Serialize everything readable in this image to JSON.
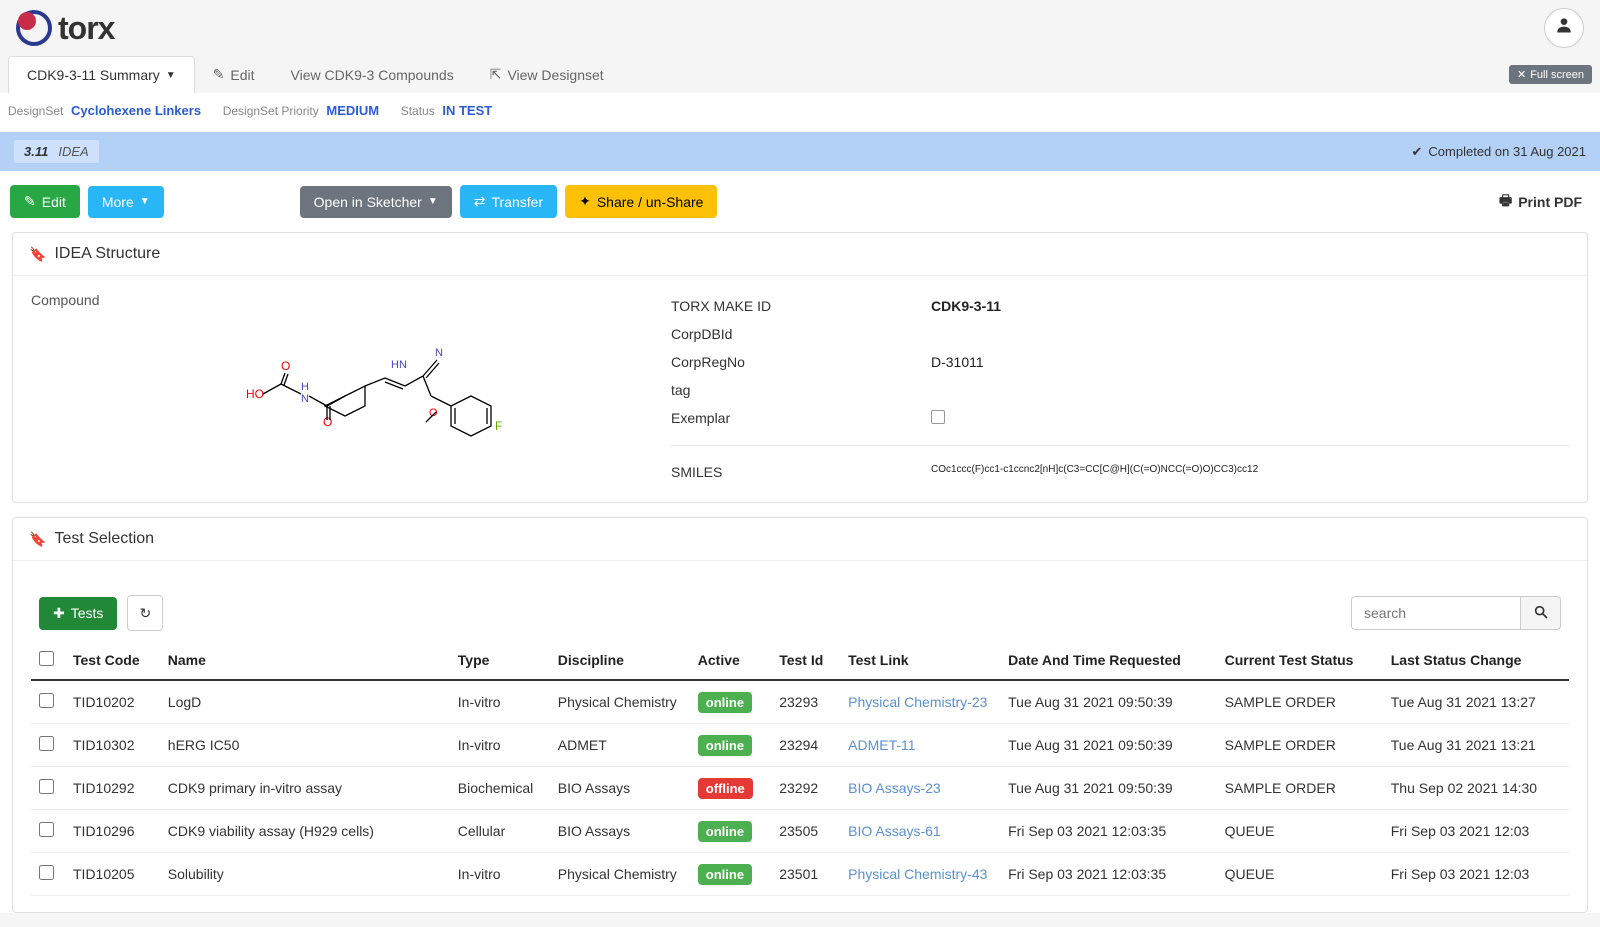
{
  "logo_text": "torx",
  "tabs": {
    "summary": "CDK9-3-11 Summary",
    "edit": "Edit",
    "view_compounds": "View CDK9-3 Compounds",
    "view_designset": "View Designset"
  },
  "fullscreen": "Full screen",
  "meta": {
    "designset_lbl": "DesignSet",
    "designset_val": "Cyclohexene Linkers",
    "priority_lbl": "DesignSet Priority",
    "priority_val": "MEDIUM",
    "status_lbl": "Status",
    "status_val": "IN TEST"
  },
  "idea_banner": {
    "num": "3.11",
    "label": "IDEA",
    "completed": "Completed on 31 Aug 2021"
  },
  "actions": {
    "edit": "Edit",
    "more": "More",
    "sketcher": "Open in Sketcher",
    "transfer": "Transfer",
    "share": "Share / un-Share",
    "print": "Print PDF"
  },
  "structure": {
    "header": "IDEA Structure",
    "compound_lbl": "Compound",
    "torx_make_id_lbl": "TORX MAKE ID",
    "torx_make_id_val": "CDK9-3-11",
    "corpdbid_lbl": "CorpDBId",
    "corpdbid_val": "",
    "corpregno_lbl": "CorpRegNo",
    "corpregno_val": "D-31011",
    "tag_lbl": "tag",
    "tag_val": "",
    "exemplar_lbl": "Exemplar",
    "smiles_lbl": "SMILES",
    "smiles_val": "COc1ccc(F)cc1-c1ccnc2[nH]c(C3=CC[C@H](C(=O)NCC(=O)O)CC3)cc12"
  },
  "tests_panel": {
    "header": "Test Selection",
    "add_btn": "Tests",
    "search_placeholder": "search"
  },
  "table": {
    "headers": {
      "code": "Test Code",
      "name": "Name",
      "type": "Type",
      "discipline": "Discipline",
      "active": "Active",
      "testid": "Test Id",
      "testlink": "Test Link",
      "requested": "Date And Time Requested",
      "status": "Current Test Status",
      "lastchange": "Last Status Change"
    },
    "rows": [
      {
        "code": "TID10202",
        "name": "LogD",
        "type": "In-vitro",
        "discipline": "Physical Chemistry",
        "active": "online",
        "testid": "23293",
        "testlink": "Physical Chemistry-23",
        "requested": "Tue Aug 31 2021 09:50:39",
        "status": "SAMPLE ORDER",
        "lastchange": "Tue Aug 31 2021 13:27"
      },
      {
        "code": "TID10302",
        "name": "hERG IC50",
        "type": "In-vitro",
        "discipline": "ADMET",
        "active": "online",
        "testid": "23294",
        "testlink": "ADMET-11",
        "requested": "Tue Aug 31 2021 09:50:39",
        "status": "SAMPLE ORDER",
        "lastchange": "Tue Aug 31 2021 13:21"
      },
      {
        "code": "TID10292",
        "name": "CDK9 primary in-vitro assay",
        "type": "Biochemical",
        "discipline": "BIO Assays",
        "active": "offline",
        "testid": "23292",
        "testlink": "BIO Assays-23",
        "requested": "Tue Aug 31 2021 09:50:39",
        "status": "SAMPLE ORDER",
        "lastchange": "Thu Sep 02 2021 14:30"
      },
      {
        "code": "TID10296",
        "name": "CDK9 viability assay (H929 cells)",
        "type": "Cellular",
        "discipline": "BIO Assays",
        "active": "online",
        "testid": "23505",
        "testlink": "BIO Assays-61",
        "requested": "Fri Sep 03 2021 12:03:35",
        "status": "QUEUE",
        "lastchange": "Fri Sep 03 2021 12:03"
      },
      {
        "code": "TID10205",
        "name": "Solubility",
        "type": "In-vitro",
        "discipline": "Physical Chemistry",
        "active": "online",
        "testid": "23501",
        "testlink": "Physical Chemistry-43",
        "requested": "Fri Sep 03 2021 12:03:35",
        "status": "QUEUE",
        "lastchange": "Fri Sep 03 2021 12:03"
      }
    ]
  }
}
